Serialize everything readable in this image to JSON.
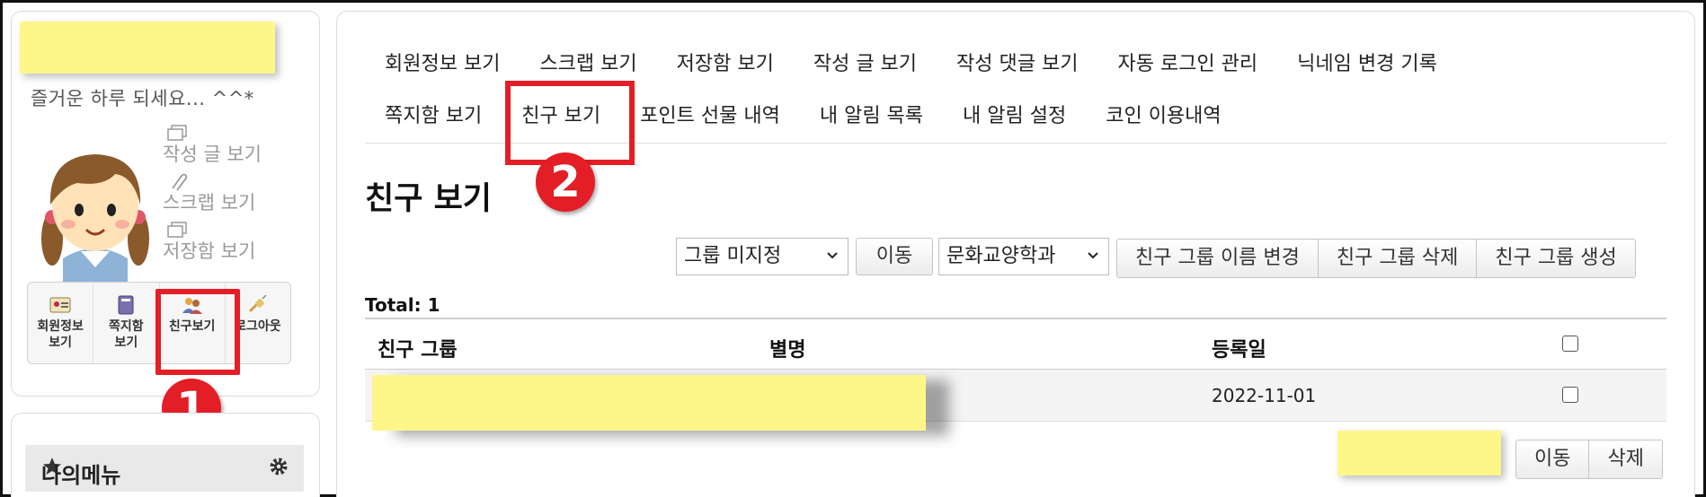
{
  "sidebar": {
    "greeting": "즐거운 하루 되세요... ^^*",
    "quick_links": [
      {
        "label": "작성 글 보기",
        "icon": "documents-icon"
      },
      {
        "label": "스크랩 보기",
        "icon": "paperclip-icon"
      },
      {
        "label": "저장함 보기",
        "icon": "folder-icon"
      }
    ],
    "buttons": [
      {
        "line1": "회원정보",
        "line2": "보기",
        "icon": "id-card-icon"
      },
      {
        "line1": "쪽지함",
        "line2": "보기",
        "icon": "notebook-icon"
      },
      {
        "line1": "친구보기",
        "line2": "",
        "icon": "friends-icon"
      },
      {
        "line1": "로그아웃",
        "line2": "",
        "icon": "plug-icon"
      }
    ],
    "mymenu_title": "나의메뉴"
  },
  "annotations": {
    "marker1": "1",
    "marker2": "2"
  },
  "tabs_row1": [
    "회원정보 보기",
    "스크랩 보기",
    "저장함 보기",
    "작성 글 보기",
    "작성 댓글 보기",
    "자동 로그인 관리",
    "닉네임 변경 기록"
  ],
  "tabs_row2": [
    "쪽지함 보기",
    "친구 보기",
    "포인트 선물 내역",
    "내 알림 목록",
    "내 알림 설정",
    "코인 이용내역"
  ],
  "page": {
    "title": "친구 보기",
    "group_select": "그룹 미지정",
    "move_button": "이동",
    "target_select": "문화교양학과",
    "group_actions": [
      "친구 그룹 이름 변경",
      "친구 그룹 삭제",
      "친구 그룹 생성"
    ],
    "total": "Total: 1",
    "columns": [
      "친구 그룹",
      "별명",
      "등록일"
    ],
    "rows": [
      {
        "date": "2022-11-01"
      }
    ],
    "bottom_buttons": [
      "이동",
      "삭제"
    ]
  },
  "colors": {
    "accent_red": "#e41e26",
    "redaction_yellow": "#fff68a"
  }
}
